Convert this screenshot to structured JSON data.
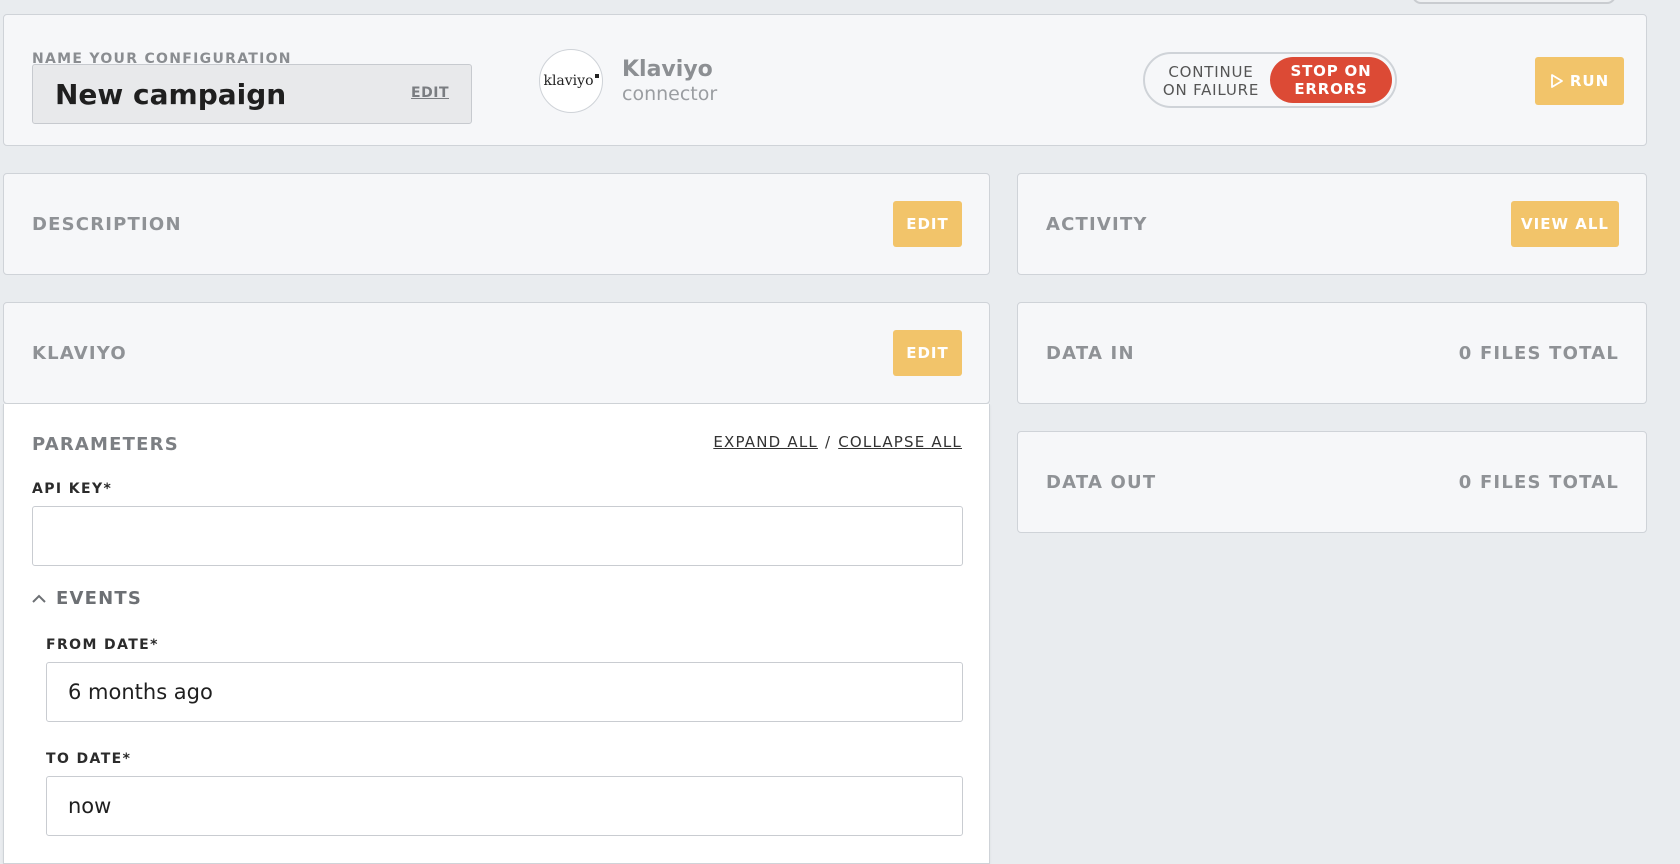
{
  "config": {
    "section_label": "NAME YOUR CONFIGURATION",
    "name": "New campaign",
    "edit_label": "EDIT"
  },
  "connector": {
    "logo_text": "klaviyo",
    "name": "Klaviyo",
    "subtitle": "connector"
  },
  "failure_mode": {
    "option_off": "CONTINUE ON FAILURE",
    "option_on": "STOP ON ERRORS",
    "selected": "STOP ON ERRORS"
  },
  "run_label": "RUN",
  "description": {
    "title": "DESCRIPTION",
    "button": "EDIT"
  },
  "activity": {
    "title": "ACTIVITY",
    "button": "VIEW ALL"
  },
  "klaviyo_section": {
    "title": "KLAVIYO",
    "button": "EDIT"
  },
  "data_in": {
    "title": "DATA IN",
    "summary": "0 FILES TOTAL"
  },
  "data_out": {
    "title": "DATA OUT",
    "summary": "0 FILES TOTAL"
  },
  "parameters": {
    "title": "PARAMETERS",
    "expand_all": "EXPAND ALL",
    "separator": "/",
    "collapse_all": "COLLAPSE ALL",
    "api_key_label": "API KEY*",
    "api_key_value": "",
    "events_label": "EVENTS",
    "from_date_label": "FROM DATE*",
    "from_date_value": "6 months ago",
    "to_date_label": "TO DATE*",
    "to_date_value": "now"
  },
  "colors": {
    "accent_yellow": "#f2c46a",
    "danger_red": "#dc4a35",
    "background": "#e9ecef"
  }
}
